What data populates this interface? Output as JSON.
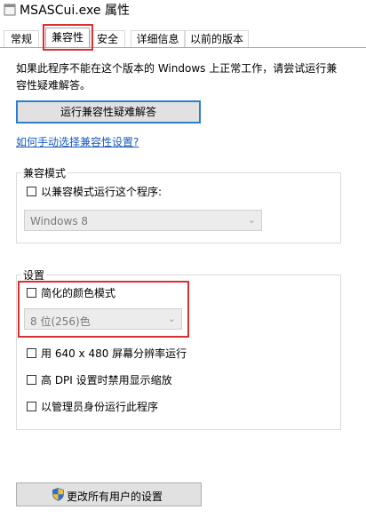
{
  "window": {
    "title": "MSASCui.exe 属性",
    "app_icon": "window-icon"
  },
  "tabs": [
    {
      "label": "常规",
      "active": false
    },
    {
      "label": "兼容性",
      "active": true
    },
    {
      "label": "安全",
      "active": false
    },
    {
      "label": "详细信息",
      "active": false
    },
    {
      "label": "以前的版本",
      "active": false
    }
  ],
  "compat": {
    "description_line1": "如果此程序不能在这个版本的 Windows 上正常工作，请尝试运行兼",
    "description_line2": "容性疑难解答。",
    "troubleshoot_button": "运行兼容性疑难解答",
    "manual_link": "如何手动选择兼容性设置?"
  },
  "compat_mode": {
    "group_label": "兼容模式",
    "checkbox_label": "以兼容模式运行这个程序:",
    "checked": false,
    "os_select_value": "Windows 8"
  },
  "settings": {
    "group_label": "设置",
    "reduced_color": {
      "label": "简化的颜色模式",
      "checked": false
    },
    "color_select_value": "8 位(256)色",
    "res_640": {
      "label": "用 640 x 480 屏幕分辨率运行",
      "checked": false
    },
    "high_dpi": {
      "label": "高 DPI 设置时禁用显示缩放",
      "checked": false
    },
    "run_admin": {
      "label": "以管理员身份运行此程序",
      "checked": false
    }
  },
  "all_users_button": "更改所有用户的设置",
  "colors": {
    "highlight": "#d93033",
    "link": "#1a5bbd",
    "focus": "#2e7ed0"
  }
}
